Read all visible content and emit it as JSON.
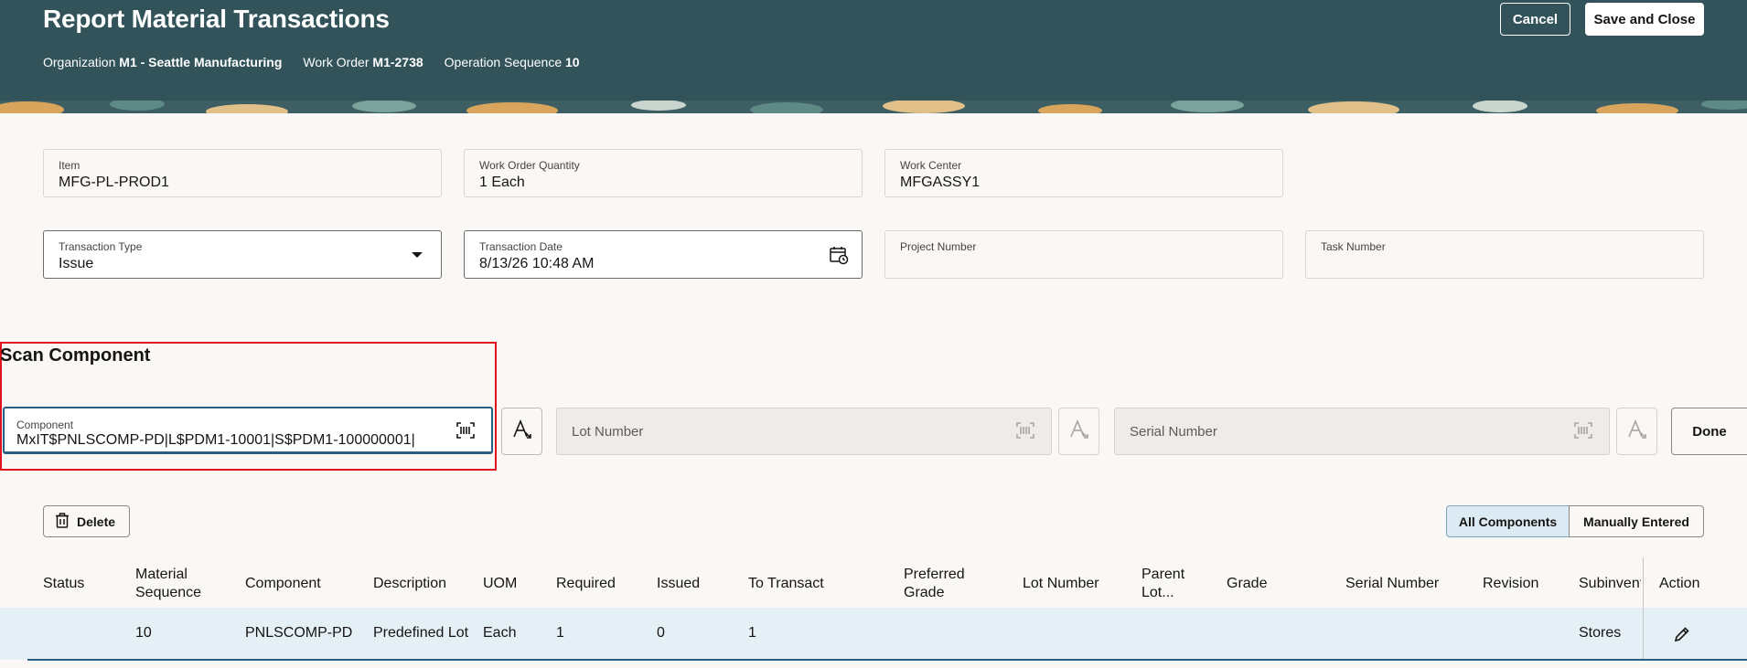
{
  "header": {
    "title": "Report Material Transactions",
    "context": [
      {
        "label": "Organization",
        "value": "M1 - Seattle Manufacturing"
      },
      {
        "label": "Work Order",
        "value": "M1-2738"
      },
      {
        "label": "Operation Sequence",
        "value": "10"
      }
    ],
    "cancel_label": "Cancel",
    "save_close_label": "Save and Close"
  },
  "fields": {
    "item": {
      "label": "Item",
      "value": "MFG-PL-PROD1"
    },
    "work_order_quantity": {
      "label": "Work Order Quantity",
      "value": "1 Each"
    },
    "work_center": {
      "label": "Work Center",
      "value": "MFGASSY1"
    },
    "transaction_type": {
      "label": "Transaction Type",
      "value": "Issue"
    },
    "transaction_date": {
      "label": "Transaction Date",
      "value": "8/13/26 10:48 AM"
    },
    "project_number": {
      "label": "Project Number",
      "value": ""
    },
    "task_number": {
      "label": "Task Number",
      "value": ""
    }
  },
  "scan": {
    "title": "Scan Component",
    "component_label": "Component",
    "component_value": "MxIT$PNLSCOMP-PD|L$PDM1-10001|S$PDM1-100000001|",
    "lot_placeholder": "Lot Number",
    "serial_placeholder": "Serial Number",
    "done_label": "Done"
  },
  "toolbar": {
    "delete_label": "Delete",
    "all_components_label": "All Components",
    "manually_entered_label": "Manually Entered"
  },
  "table": {
    "columns": {
      "status": "Status",
      "material_sequence": "Material Sequence",
      "component": "Component",
      "description": "Description",
      "uom": "UOM",
      "required": "Required",
      "issued": "Issued",
      "to_transact": "To Transact",
      "preferred_grade": "Preferred Grade",
      "lot_number": "Lot Number",
      "parent_lot": "Parent Lot...",
      "grade": "Grade",
      "serial_number": "Serial Number",
      "revision": "Revision",
      "subinventory": "Subinventory",
      "action": "Action"
    },
    "rows": [
      {
        "status": "",
        "material_sequence": "10",
        "component": "PNLSCOMP-PD",
        "description": "Predefined Lot",
        "uom": "Each",
        "required": "1",
        "issued": "0",
        "to_transact": "1",
        "subinventory": "Stores"
      }
    ]
  },
  "colors": {
    "header_bg": "#32535a",
    "accent": "#2a5f82",
    "highlight": "#e0141e",
    "row_selected": "#e4eff6"
  }
}
